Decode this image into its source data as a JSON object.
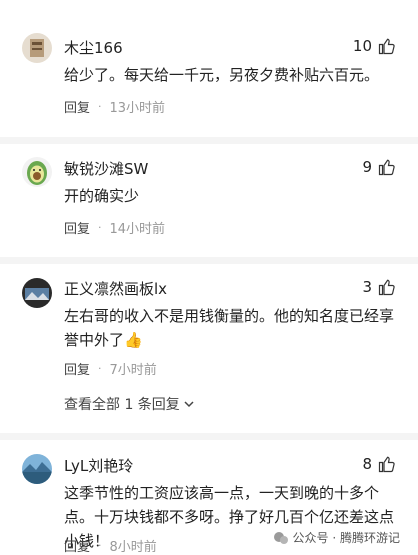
{
  "comments": [
    {
      "username": "木尘166",
      "likes": "10",
      "text": "给少了。每天给一千元，另夜夕费补贴六百元。",
      "reply": "回复",
      "time": "13小时前",
      "avatar": "book-icon"
    },
    {
      "username": "敏锐沙滩SW",
      "likes": "9",
      "text": "开的确实少",
      "reply": "回复",
      "time": "14小时前",
      "avatar": "avocado-icon"
    },
    {
      "username": "正义凛然画板lx",
      "likes": "3",
      "text": "左右哥的收入不是用钱衡量的。他的知名度已经享誉中外了👍",
      "reply": "回复",
      "time": "7小时前",
      "avatar": "landscape-icon"
    },
    {
      "username": "LyL刘艳玲",
      "likes": "8",
      "text": "这季节性的工资应该高一点，一天到晚的十多个点。十万块钱都不多呀。挣了好几百个亿还差这点小钱！",
      "reply": "回复",
      "time": "8小时前",
      "avatar": "lake-icon"
    }
  ],
  "view_all_replies": "查看全部 1 条回复",
  "watermark": "公众号 · 腾腾环游记",
  "colors": {
    "text": "#222222",
    "meta": "#999999",
    "divider": "#f4f4f4"
  }
}
